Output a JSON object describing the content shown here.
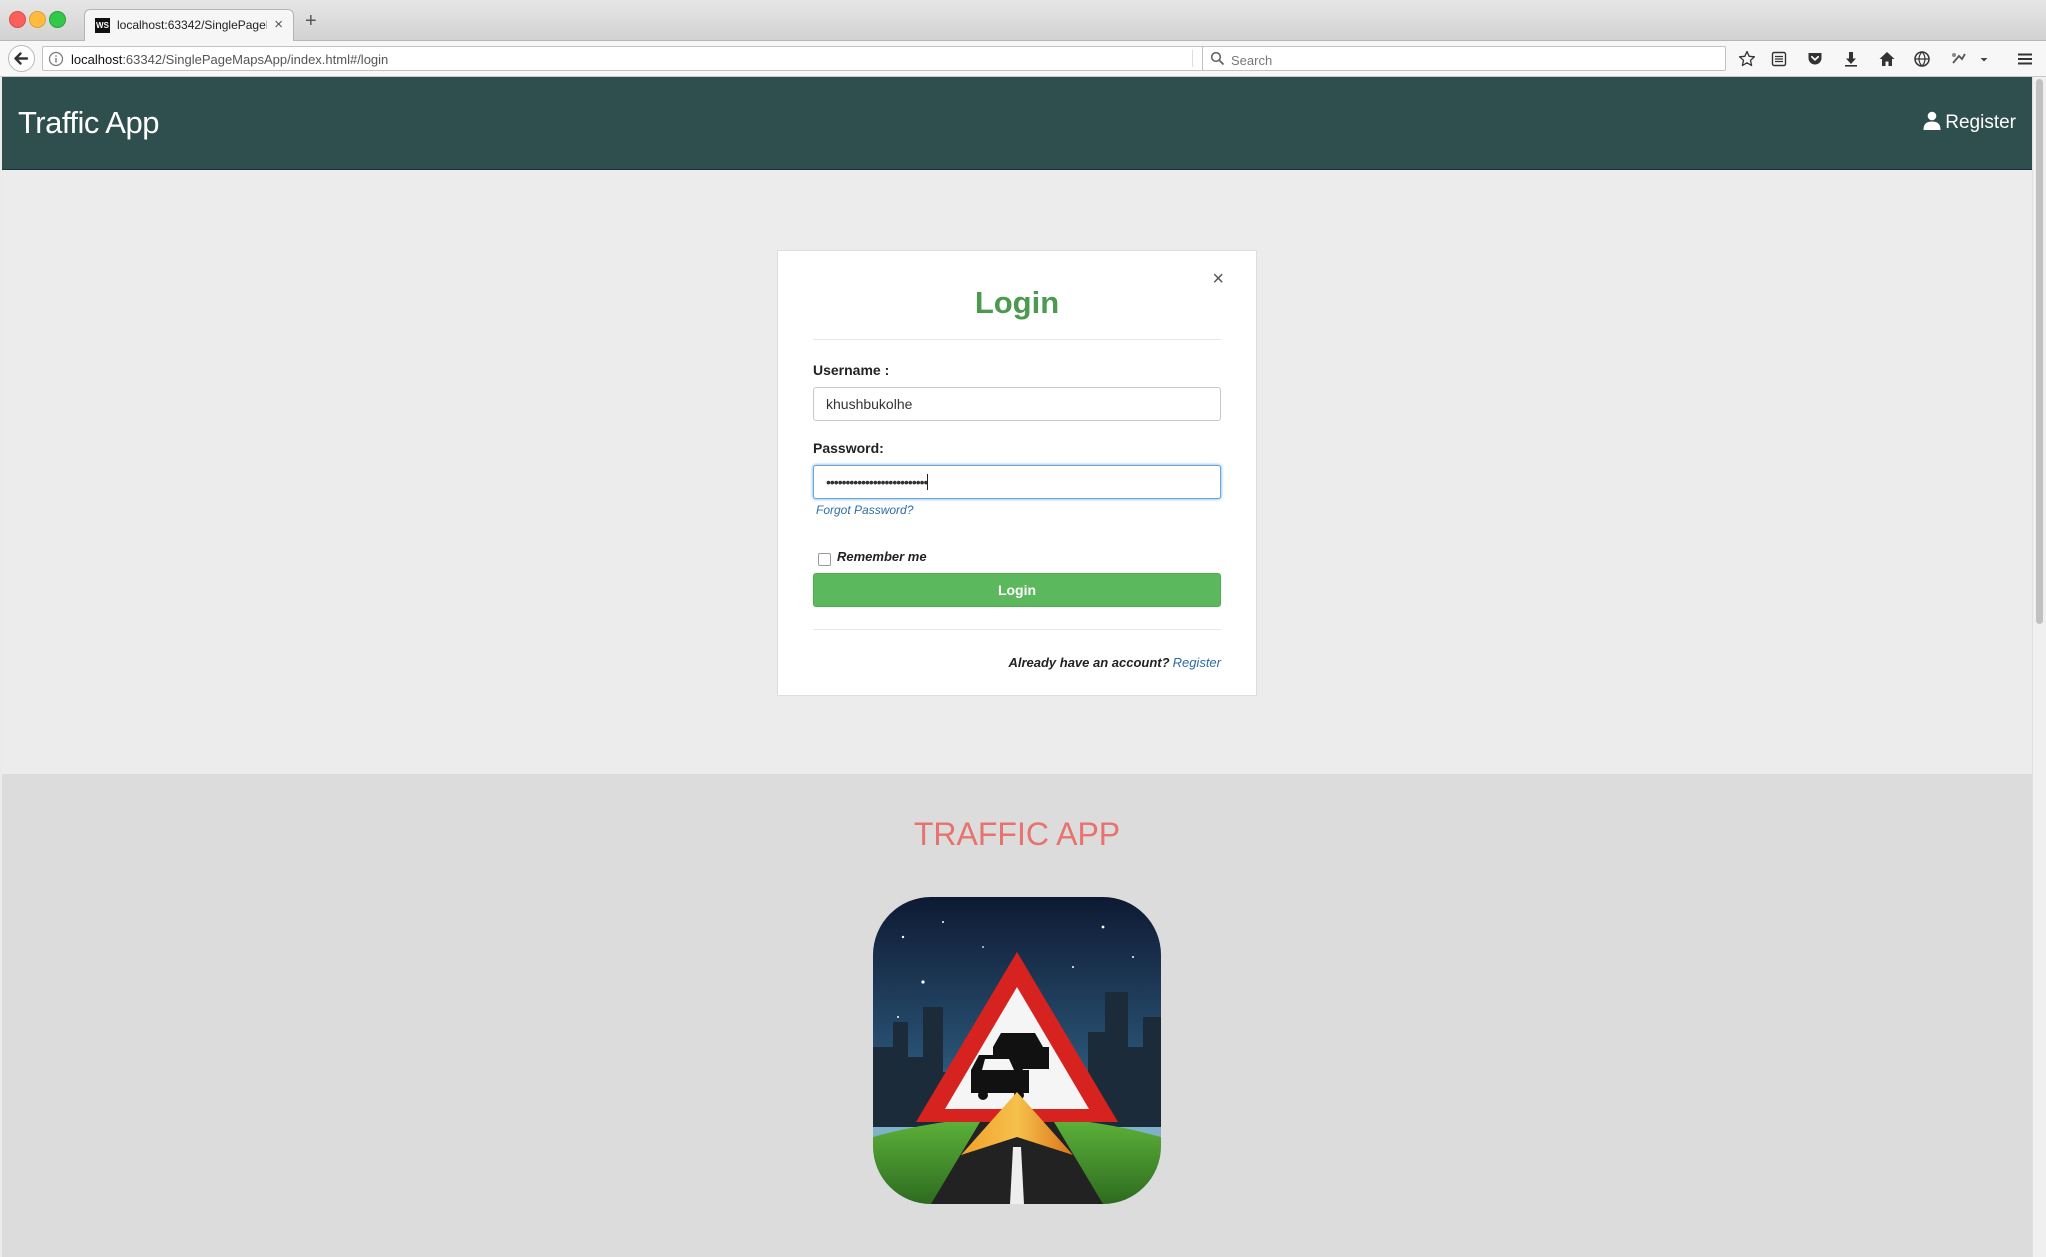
{
  "browser": {
    "tab_title": "localhost:63342/SinglePageMapsApp/index.html#/login",
    "favicon_text": "WS",
    "url_host": "localhost",
    "url_rest": ":63342/SinglePageMapsApp/index.html#/login",
    "search_placeholder": "Search"
  },
  "header": {
    "brand": "Traffic App",
    "register_label": "Register"
  },
  "login": {
    "title": "Login",
    "close_glyph": "×",
    "username_label": "Username :",
    "username_value": "khushbukolhe",
    "password_label": "Password:",
    "password_value": "••••••••••••••••••••••••••",
    "forgot_label": "Forgot Password?",
    "remember_label": "Remember me",
    "remember_checked": false,
    "button_label": "Login",
    "account_prompt": "Already have an account?",
    "account_link": "Register"
  },
  "lower": {
    "title": "TRAFFIC APP"
  },
  "colors": {
    "header_bg": "#2f4f4f",
    "title_green": "#4b9a50",
    "button_green": "#5cb85c",
    "link_blue": "#2f6ca7",
    "lower_title": "#e8736e"
  }
}
